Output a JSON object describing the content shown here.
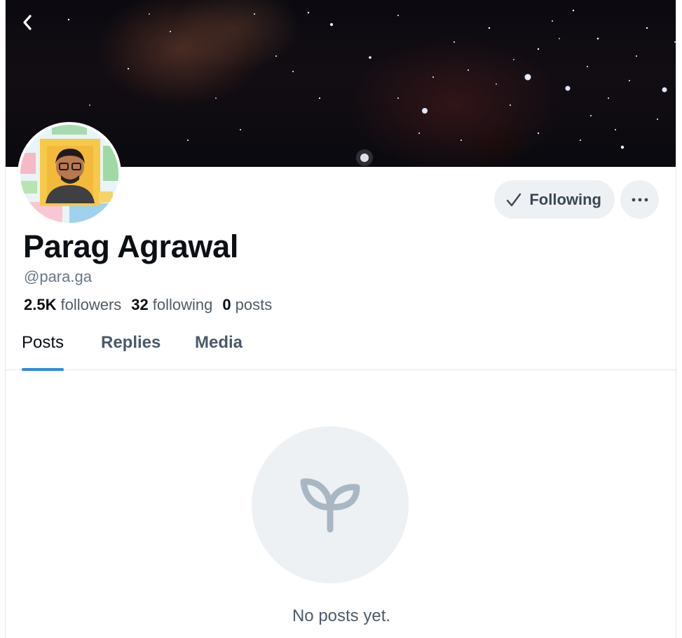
{
  "profile": {
    "display_name": "Parag Agrawal",
    "handle": "@para.ga",
    "followers_count": "2.5K",
    "followers_label": "followers",
    "following_count": "32",
    "following_label": "following",
    "posts_count": "0",
    "posts_label": "posts"
  },
  "actions": {
    "following_label": "Following",
    "more_label": "···"
  },
  "tabs": [
    {
      "label": "Posts",
      "active": true
    },
    {
      "label": "Replies",
      "active": false
    },
    {
      "label": "Media",
      "active": false
    }
  ],
  "empty_state": {
    "message": "No posts yet.",
    "icon": "sprout-icon"
  },
  "colors": {
    "accent": "#2a8be0",
    "button_bg": "#eef1f4",
    "muted_text": "#6a7785"
  }
}
